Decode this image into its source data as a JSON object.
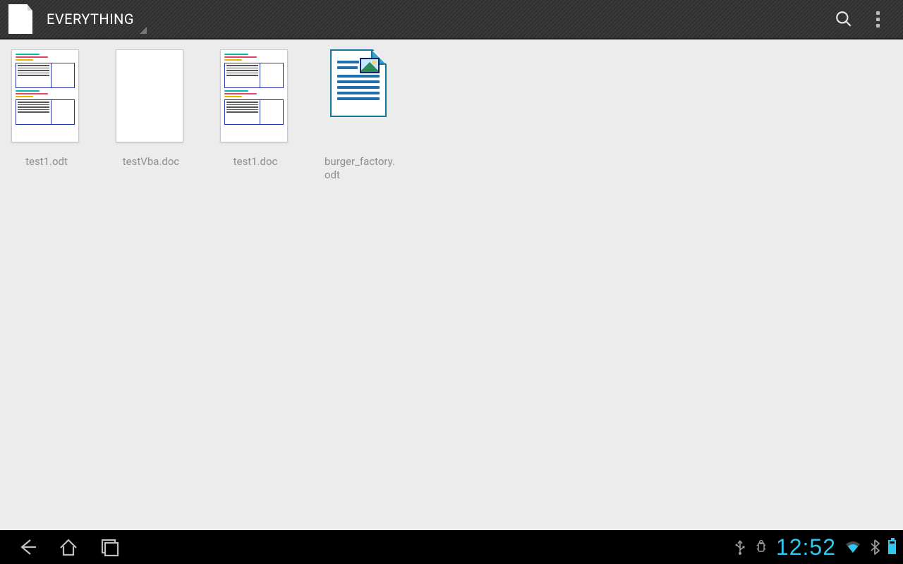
{
  "action_bar": {
    "title": "EVERYTHING"
  },
  "files": [
    {
      "name": "test1.odt",
      "thumb": "tabledoc"
    },
    {
      "name": "testVba.doc",
      "thumb": "blank"
    },
    {
      "name": "test1.doc",
      "thumb": "tabledoc"
    },
    {
      "name": "burger_factory.odt",
      "thumb": "lowriter"
    }
  ],
  "sysbar": {
    "clock": "12:52"
  }
}
